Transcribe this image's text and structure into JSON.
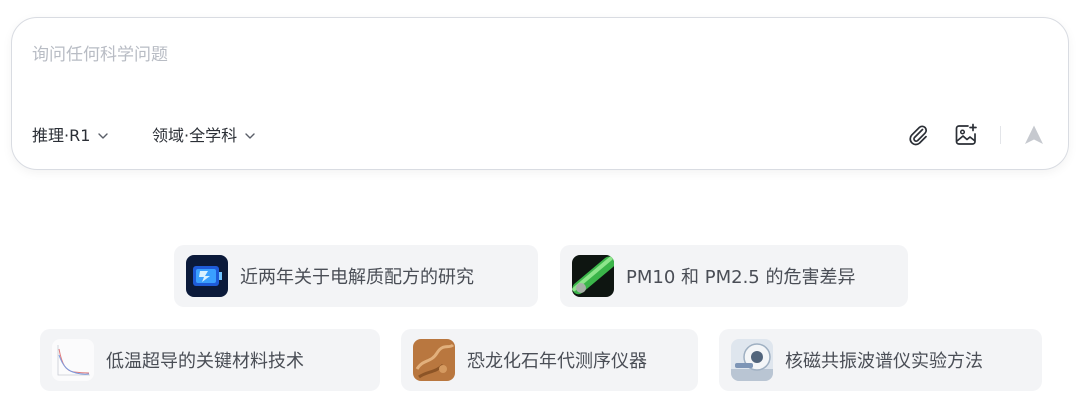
{
  "composer": {
    "placeholder": "询问任何科学问题",
    "model_selector": "推理·R1",
    "domain_selector": "领域·全学科"
  },
  "icons": {
    "attach": "paperclip-icon",
    "image_upload": "image-plus-icon",
    "send": "send-icon",
    "dropdown": "chevron-down-icon"
  },
  "suggestions": [
    {
      "label": "近两年关于电解质配方的研究",
      "thumb": "battery-thumbnail"
    },
    {
      "label": "PM10 和 PM2.5 的危害差异",
      "thumb": "green-tube-thumbnail"
    },
    {
      "label": "低温超导的关键材料技术",
      "thumb": "chart-thumbnail"
    },
    {
      "label": "恐龙化石年代测序仪器",
      "thumb": "fossil-thumbnail"
    },
    {
      "label": "核磁共振波谱仪实验方法",
      "thumb": "mri-thumbnail"
    }
  ],
  "colors": {
    "border": "#d9dce2",
    "chip_bg": "#f3f4f6",
    "placeholder": "#b8bcc4",
    "text": "#2b2f36",
    "send_disabled": "#c6c9cf"
  }
}
